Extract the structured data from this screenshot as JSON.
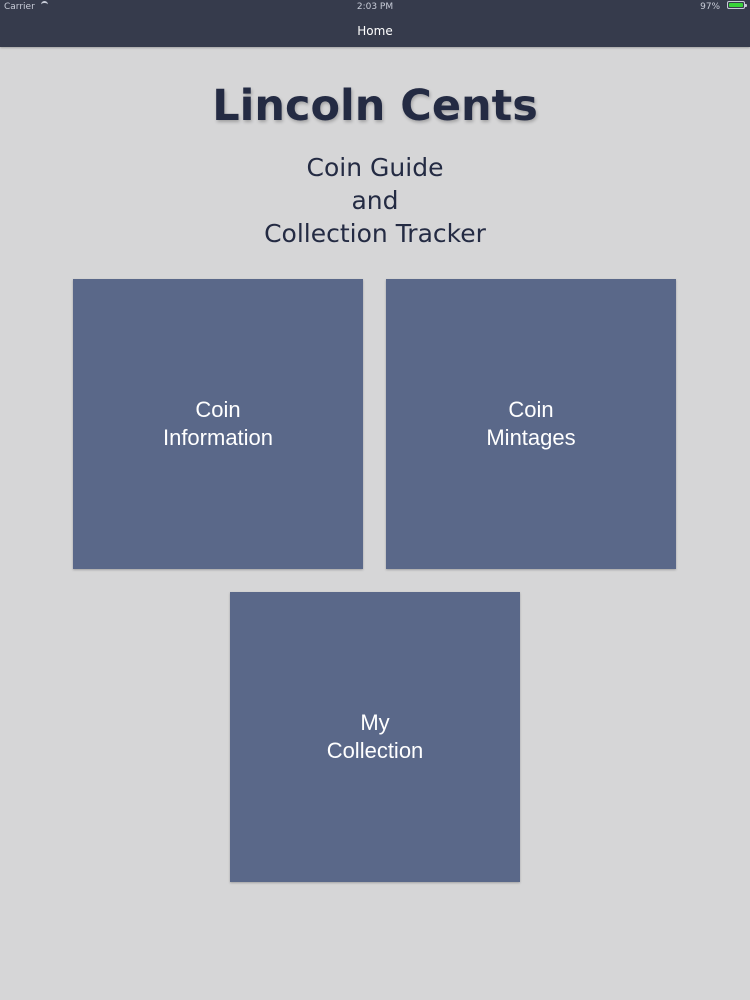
{
  "status_bar": {
    "carrier": "Carrier",
    "time": "2:03 PM",
    "battery": "97%",
    "battery_fill_fraction": 0.97
  },
  "nav": {
    "title": "Home"
  },
  "header": {
    "title": "Lincoln Cents",
    "subtitle": [
      "Coin Guide",
      "and",
      "Collection Tracker"
    ]
  },
  "tiles": [
    {
      "line1": "Coin",
      "line2": "Information"
    },
    {
      "line1": "Coin",
      "line2": "Mintages"
    },
    {
      "line1": "My",
      "line2": "Collection"
    }
  ],
  "colors": {
    "nav_background": "#363b4c",
    "page_background": "#d6d6d7",
    "tile_background": "#5a6889",
    "title_text": "#242b43"
  },
  "icons": [
    "wifi-icon",
    "battery-icon"
  ]
}
